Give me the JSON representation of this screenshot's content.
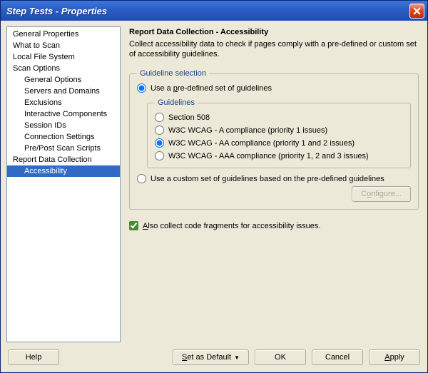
{
  "window": {
    "title": "Step Tests - Properties"
  },
  "tree": {
    "items": [
      {
        "label": "General Properties",
        "indent": 0
      },
      {
        "label": "What to Scan",
        "indent": 0
      },
      {
        "label": "Local File System",
        "indent": 0
      },
      {
        "label": "Scan Options",
        "indent": 0
      },
      {
        "label": "General Options",
        "indent": 1
      },
      {
        "label": "Servers and Domains",
        "indent": 1
      },
      {
        "label": "Exclusions",
        "indent": 1
      },
      {
        "label": "Interactive Components",
        "indent": 1
      },
      {
        "label": "Session IDs",
        "indent": 1
      },
      {
        "label": "Connection Settings",
        "indent": 1
      },
      {
        "label": "Pre/Post Scan Scripts",
        "indent": 1
      },
      {
        "label": "Report Data Collection",
        "indent": 0
      },
      {
        "label": "Accessibility",
        "indent": 1,
        "selected": true
      }
    ]
  },
  "main": {
    "heading": "Report Data Collection - Accessibility",
    "description": "Collect accessibility data to check if pages comply with a pre-defined or custom set of accessibility guidelines.",
    "guideline_selection_legend": "Guideline selection",
    "use_predefined_label_pre": "Use a ",
    "use_predefined_label_u": "p",
    "use_predefined_label_post": "re-defined set of guidelines",
    "guidelines_legend": "Guidelines",
    "options": [
      "Section 508",
      "W3C WCAG - A compliance (priority 1 issues)",
      "W3C WCAG - AA compliance (priority 1 and 2 issues)",
      "W3C WCAG - AAA compliance (priority 1, 2 and 3 issues)"
    ],
    "use_custom_label": "Use a custom set of guidelines based on the pre-defined guidelines",
    "configure_label_pre": "C",
    "configure_label_u": "o",
    "configure_label_post": "nfigure...",
    "collect_fragments_pre": "",
    "collect_fragments_u": "A",
    "collect_fragments_post": "lso collect code fragments for accessibility issues."
  },
  "footer": {
    "help": "Help",
    "set_default_pre": "",
    "set_default_u": "S",
    "set_default_post": "et as Default",
    "ok": "OK",
    "cancel": "Cancel",
    "apply_pre": "",
    "apply_u": "A",
    "apply_post": "pply"
  }
}
